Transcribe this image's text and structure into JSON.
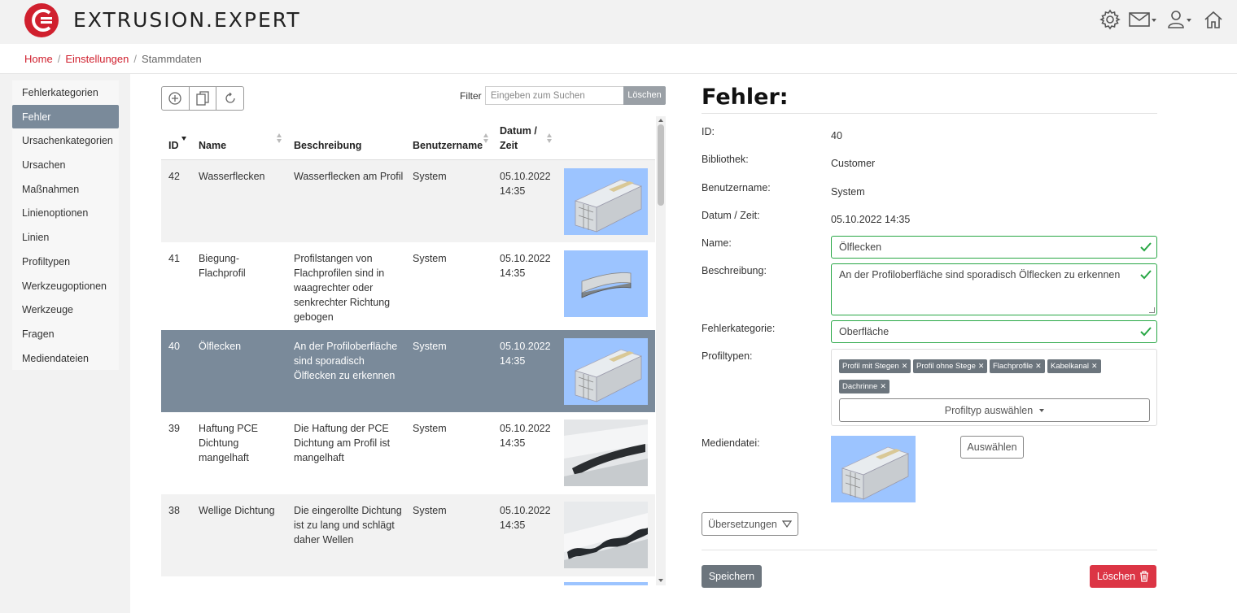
{
  "header": {
    "brand": "EXTRUSION.EXPERT",
    "icons": [
      "gear-icon",
      "mail-icon",
      "user-icon",
      "home-icon"
    ]
  },
  "breadcrumb": {
    "home": "Home",
    "settings": "Einstellungen",
    "current": "Stammdaten",
    "sep": "/"
  },
  "sidebar": {
    "items": [
      {
        "label": "Fehlerkategorien"
      },
      {
        "label": "Fehler",
        "active": true
      },
      {
        "label": "Ursachenkategorien"
      },
      {
        "label": "Ursachen"
      },
      {
        "label": "Maßnahmen"
      },
      {
        "label": "Linienoptionen"
      },
      {
        "label": "Linien"
      },
      {
        "label": "Profiltypen"
      },
      {
        "label": "Werkzeugoptionen"
      },
      {
        "label": "Werkzeuge"
      },
      {
        "label": "Fragen"
      },
      {
        "label": "Mediendateien"
      }
    ]
  },
  "toolbar": {
    "filter_label": "Filter",
    "filter_placeholder": "Eingeben zum Suchen",
    "clear_label": "Löschen"
  },
  "table": {
    "columns": {
      "id": "ID",
      "name": "Name",
      "desc": "Beschreibung",
      "user": "Benutzername",
      "date1": "Datum /",
      "date2": "Zeit"
    },
    "rows": [
      {
        "id": "42",
        "name1": "Wasserflecken",
        "name2": "",
        "name3": "",
        "d1": "Wasserflecken am Profil",
        "d2": "",
        "d3": "",
        "d4": "",
        "user": "System",
        "date": "05.10.2022",
        "time": "14:35"
      },
      {
        "id": "41",
        "name1": "Biegung-",
        "name2": "Flachprofil",
        "name3": "",
        "d1": "Profilstangen von",
        "d2": "Flachprofilen sind in",
        "d3": "waagrechter oder",
        "d4": "senkrechter Richtung",
        "d5": "gebogen",
        "user": "System",
        "date": "05.10.2022",
        "time": "14:35"
      },
      {
        "id": "40",
        "name1": "Ölflecken",
        "name2": "",
        "name3": "",
        "d1": "An der Profiloberfläche",
        "d2": "sind sporadisch",
        "d3": "Ölflecken zu erkennen",
        "d4": "",
        "user": "System",
        "date": "05.10.2022",
        "time": "14:35"
      },
      {
        "id": "39",
        "name1": "Haftung PCE",
        "name2": "Dichtung",
        "name3": "mangelhaft",
        "d1": "Die Haftung der PCE",
        "d2": "Dichtung am Profil ist",
        "d3": "mangelhaft",
        "d4": "",
        "user": "System",
        "date": "05.10.2022",
        "time": "14:35"
      },
      {
        "id": "38",
        "name1": "Wellige Dichtung",
        "name2": "",
        "name3": "",
        "d1": "Die eingerollte Dichtung",
        "d2": "ist zu lang und schlägt",
        "d3": "daher Wellen",
        "d4": "",
        "user": "System",
        "date": "05.10.2022",
        "time": "14:35"
      }
    ]
  },
  "detail": {
    "title": "Fehler:",
    "id_label": "ID:",
    "id_value": "40",
    "lib_label": "Bibliothek:",
    "lib_value": "Customer",
    "user_label": "Benutzername:",
    "user_value": "System",
    "date_label": "Datum / Zeit:",
    "date_value": "05.10.2022 14:35",
    "name_label": "Name:",
    "name_value": "Ölflecken",
    "desc_label": "Beschreibung:",
    "desc_value": "An der Profiloberfläche  sind sporadisch Ölflecken zu erkennen",
    "cat_label": "Fehlerkategorie:",
    "cat_value": "Oberfläche",
    "ptypes_label": "Profiltypen:",
    "tags": [
      "Profil mit Stegen",
      "Profil ohne Stege",
      "Flachprofile",
      "Kabelkanal",
      "Dachrinne"
    ],
    "ptype_select": "Profiltyp auswählen",
    "media_label": "Mediendatei:",
    "media_btn": "Auswählen",
    "translations": "Übersetzungen",
    "save": "Speichern",
    "delete": "Löschen"
  },
  "colors": {
    "brand_red": "#d0202e",
    "selected_row": "#7a8a9a",
    "valid_green": "#28a745",
    "danger": "#dc3545"
  }
}
